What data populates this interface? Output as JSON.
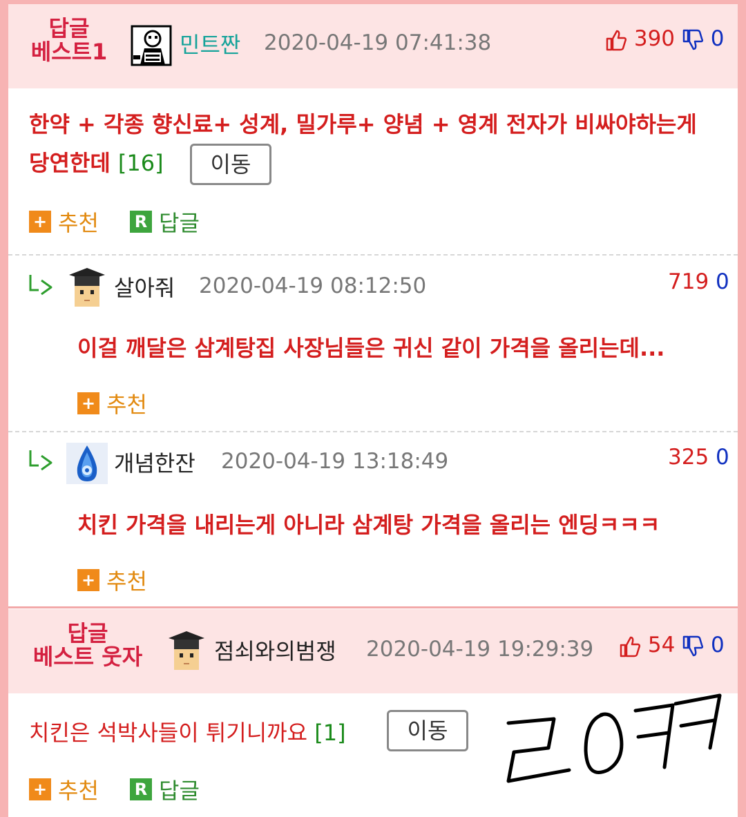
{
  "best1": {
    "label_line1": "답글",
    "label_line2": "베스트1",
    "nickname": "민트짠",
    "date": "2020-04-19 07:41:38",
    "up": "390",
    "down": "0",
    "content": "한약 + 각종 향신료+ 성계, 밀가루+ 양념 + 영계 전자가 비싸야하는게",
    "content_line2": "당연한데",
    "comment_count": "[16]",
    "move_label": "이동",
    "recommend_label": "추천",
    "reply_label": "답글",
    "reply_icon_letter": "R",
    "plus_icon": "+"
  },
  "replies": [
    {
      "nickname": "살아줘",
      "date": "2020-04-19 08:12:50",
      "up": "719",
      "down": "0",
      "content": "이걸 깨달은 삼계탕집 사장님들은 귀신 같이 가격을 올리는데...",
      "recommend_label": "추천",
      "plus_icon": "+"
    },
    {
      "nickname": "개념한잔",
      "date": "2020-04-19 13:18:49",
      "up": "325",
      "down": "0",
      "content": "치킨 가격을 내리는게 아니라 삼계탕 가격을 올리는 엔딩ㅋㅋㅋ",
      "recommend_label": "추천",
      "plus_icon": "+"
    }
  ],
  "best_funny": {
    "label_line1": "답글",
    "label_line2": "베스트 웃자",
    "nickname": "점쇠와의범쟁",
    "date": "2020-04-19 19:29:39",
    "up": "54",
    "down": "0",
    "content": "치킨은 석박사들이 튀기니까요",
    "comment_count": "[1]",
    "move_label": "이동",
    "recommend_label": "추천",
    "reply_label": "답글",
    "reply_icon_letter": "R",
    "plus_icon": "+"
  },
  "handwriting": "ㄹㅇㅋㅋ",
  "colors": {
    "border": "#f7b3b3",
    "best_bg": "#fde4e4",
    "accent_red": "#d41e1e",
    "down_blue": "#1030c0",
    "count_green": "#1a8a1a",
    "recommend_orange": "#f08a1a"
  }
}
